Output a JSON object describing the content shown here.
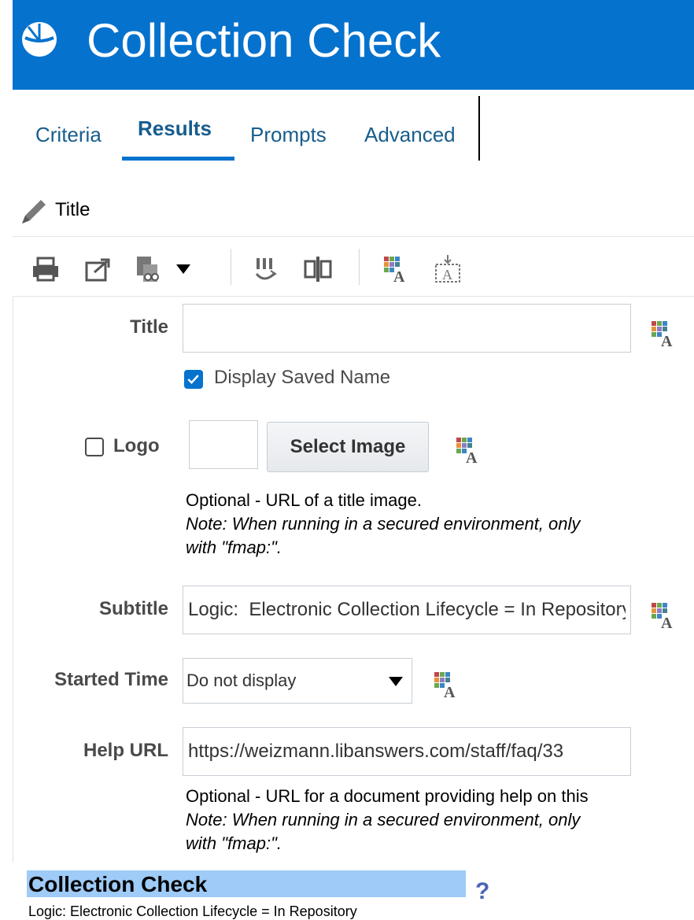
{
  "header": {
    "title": "Collection Check",
    "icon": "analysis-icon"
  },
  "tabs": [
    {
      "label": "Criteria",
      "active": false
    },
    {
      "label": "Results",
      "active": true
    },
    {
      "label": "Prompts",
      "active": false
    },
    {
      "label": "Advanced",
      "active": false
    }
  ],
  "breadcrumb": {
    "label": "Title",
    "icon": "pencil-icon"
  },
  "toolbar": {
    "icons": [
      "print-icon",
      "export-icon",
      "copy-dropdown-icon",
      "edit-data-icon",
      "columns-icon",
      "format-icon",
      "insert-text-icon"
    ]
  },
  "form": {
    "title_label": "Title",
    "title_value": "",
    "display_saved_name_label": "Display Saved Name",
    "display_saved_name_checked": true,
    "logo_label": "Logo",
    "logo_checked": false,
    "select_image_label": "Select Image",
    "logo_hint": "Optional - URL of a title image.",
    "logo_note_line1": "Note: When running in a secured environment, only",
    "logo_note_line2": "with \"fmap:\".",
    "subtitle_label": "Subtitle",
    "subtitle_value": "Logic:  Electronic Collection Lifecycle = In Repository",
    "started_time_label": "Started Time",
    "started_time_value": "Do not display",
    "help_url_label": "Help URL",
    "help_url_value": "https://weizmann.libanswers.com/staff/faq/33",
    "help_hint": "Optional - URL for a document providing help on this",
    "help_note_line1": "Note: When running in a secured environment, only",
    "help_note_line2": "with \"fmap:\"."
  },
  "preview": {
    "title": "Collection Check",
    "help": "?",
    "subtitle": "Logic: Electronic Collection Lifecycle = In Repository"
  },
  "colors": {
    "header": "#0572ce",
    "preview_highlight": "#9ecbf7",
    "link": "#175d8d"
  }
}
